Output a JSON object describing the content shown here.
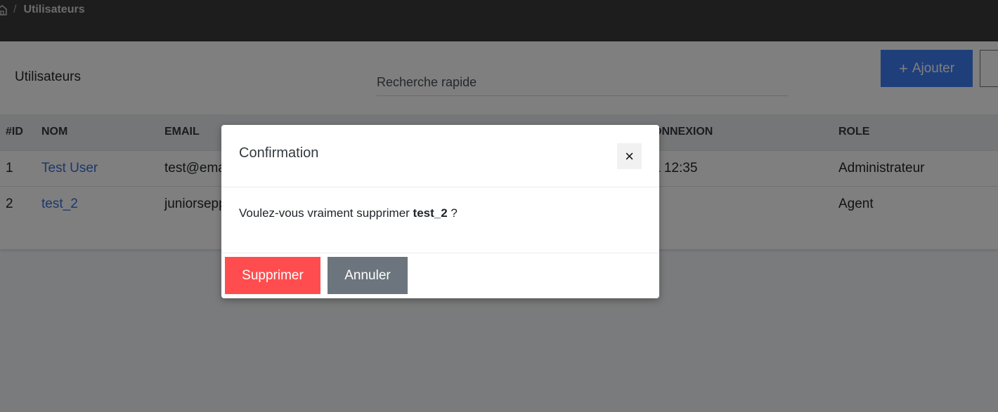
{
  "breadcrumb": {
    "separator": "/",
    "current": "Utilisateurs"
  },
  "page": {
    "title": "Utilisateurs"
  },
  "search": {
    "placeholder": "Recherche rapide"
  },
  "toolbar": {
    "add_label": "Ajouter",
    "add_icon": "+"
  },
  "table": {
    "columns": [
      "#ID",
      "NOM",
      "EMAIL",
      "ONNEXION",
      "ROLE"
    ],
    "rows": [
      {
        "id": "1",
        "name": "Test User",
        "email": "test@ema",
        "connexion": "à 12:35",
        "role": "Administrateur"
      },
      {
        "id": "2",
        "name": "test_2",
        "email": "juniorsepp",
        "connexion": "",
        "role": "Agent"
      }
    ]
  },
  "modal": {
    "title": "Confirmation",
    "close_icon": "×",
    "message_prefix": "Voulez-vous vraiment supprimer ",
    "message_target": "test_2",
    "message_suffix": " ?",
    "confirm_label": "Supprimer",
    "cancel_label": "Annuler"
  },
  "colors": {
    "primary": "#3f7ff7",
    "danger": "#ff4d4f",
    "secondary": "#6c757d",
    "topbar": "#3a3a3a"
  }
}
